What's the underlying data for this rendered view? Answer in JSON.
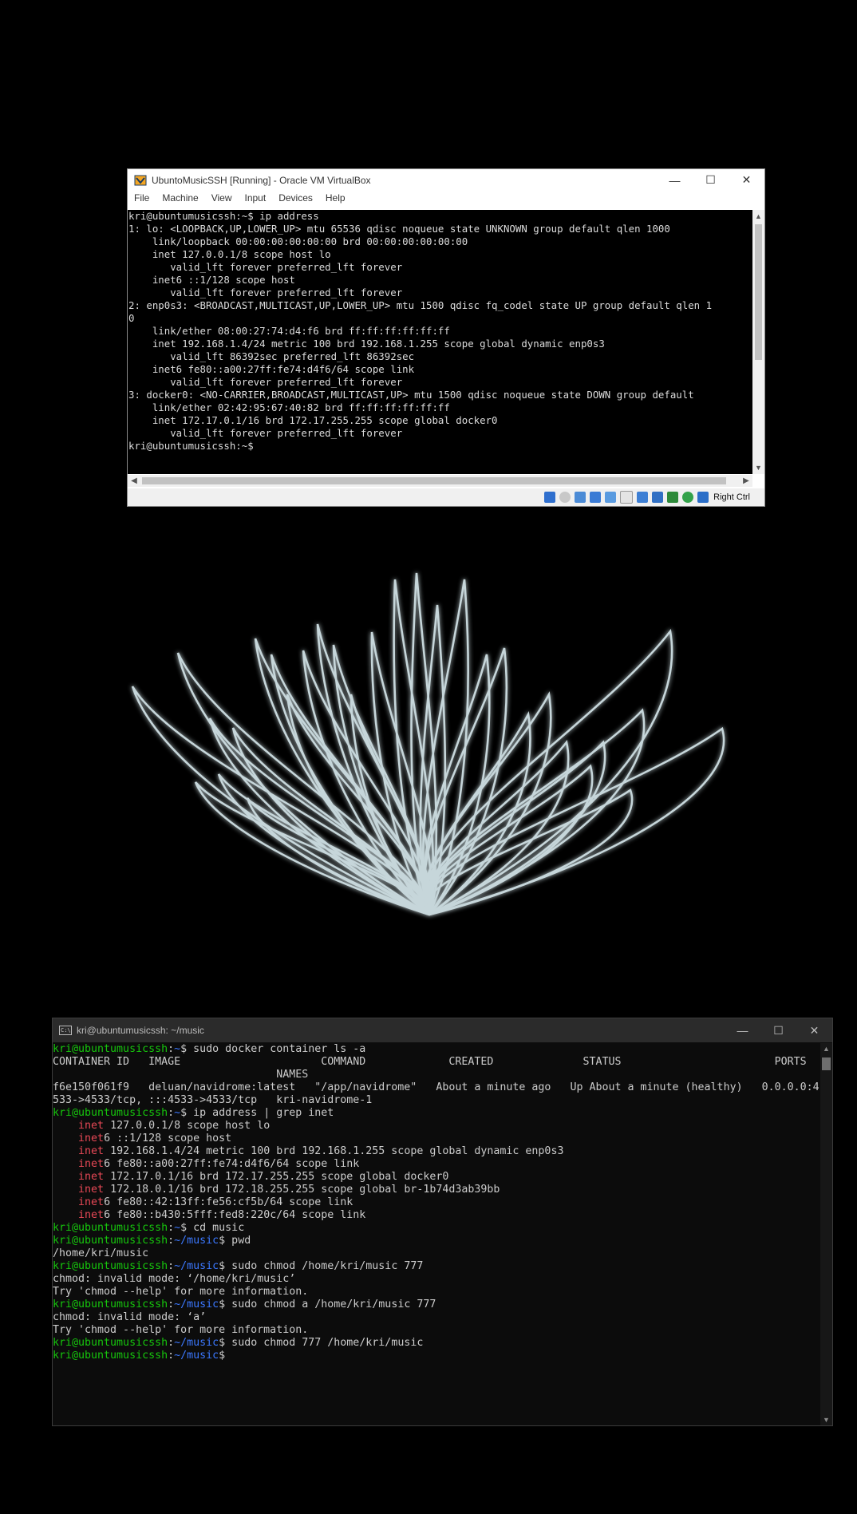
{
  "vbox": {
    "title": "UbuntoMusicSSH [Running] - Oracle VM VirtualBox",
    "menu": [
      "File",
      "Machine",
      "View",
      "Input",
      "Devices",
      "Help"
    ],
    "host_key": "Right Ctrl",
    "terminal_lines": [
      "kri@ubuntumusicssh:~$ ip address",
      "1: lo: <LOOPBACK,UP,LOWER_UP> mtu 65536 qdisc noqueue state UNKNOWN group default qlen 1000",
      "    link/loopback 00:00:00:00:00:00 brd 00:00:00:00:00:00",
      "    inet 127.0.0.1/8 scope host lo",
      "       valid_lft forever preferred_lft forever",
      "    inet6 ::1/128 scope host",
      "       valid_lft forever preferred_lft forever",
      "2: enp0s3: <BROADCAST,MULTICAST,UP,LOWER_UP> mtu 1500 qdisc fq_codel state UP group default qlen 1",
      "0",
      "    link/ether 08:00:27:74:d4:f6 brd ff:ff:ff:ff:ff:ff",
      "    inet 192.168.1.4/24 metric 100 brd 192.168.1.255 scope global dynamic enp0s3",
      "       valid_lft 86392sec preferred_lft 86392sec",
      "    inet6 fe80::a00:27ff:fe74:d4f6/64 scope link",
      "       valid_lft forever preferred_lft forever",
      "3: docker0: <NO-CARRIER,BROADCAST,MULTICAST,UP> mtu 1500 qdisc noqueue state DOWN group default",
      "    link/ether 02:42:95:67:40:82 brd ff:ff:ff:ff:ff:ff",
      "    inet 172.17.0.1/16 brd 172.17.255.255 scope global docker0",
      "       valid_lft forever preferred_lft forever",
      "kri@ubuntumusicssh:~$"
    ]
  },
  "wt": {
    "title": "kri@ubuntumusicssh: ~/music",
    "lines": [
      [
        {
          "t": "kri@ubuntumusicssh",
          "c": "green"
        },
        {
          "t": ":",
          "c": "white"
        },
        {
          "t": "~",
          "c": "blue"
        },
        {
          "t": "$ sudo docker container ls -a",
          "c": "white"
        }
      ],
      [
        {
          "t": "CONTAINER ID   IMAGE                      COMMAND             CREATED              STATUS                        PORTS",
          "c": "white"
        }
      ],
      [
        {
          "t": "                                   NAMES",
          "c": "white"
        }
      ],
      [
        {
          "t": "f6e150f061f9   deluan/navidrome:latest   \"/app/navidrome\"   About a minute ago   Up About a minute (healthy)   0.0.0.0:4",
          "c": "white"
        }
      ],
      [
        {
          "t": "533->4533/tcp, :::4533->4533/tcp   kri-navidrome-1",
          "c": "white"
        }
      ],
      [
        {
          "t": "kri@ubuntumusicssh",
          "c": "green"
        },
        {
          "t": ":",
          "c": "white"
        },
        {
          "t": "~",
          "c": "blue"
        },
        {
          "t": "$ ip address | grep inet",
          "c": "white"
        }
      ],
      [
        {
          "t": "    ",
          "c": "white"
        },
        {
          "t": "inet",
          "c": "red"
        },
        {
          "t": " 127.0.0.1/8 scope host lo",
          "c": "white"
        }
      ],
      [
        {
          "t": "    ",
          "c": "white"
        },
        {
          "t": "inet",
          "c": "red"
        },
        {
          "t": "6 ::1/128 scope host",
          "c": "white"
        }
      ],
      [
        {
          "t": "    ",
          "c": "white"
        },
        {
          "t": "inet",
          "c": "red"
        },
        {
          "t": " 192.168.1.4/24 metric 100 brd 192.168.1.255 scope global dynamic enp0s3",
          "c": "white"
        }
      ],
      [
        {
          "t": "    ",
          "c": "white"
        },
        {
          "t": "inet",
          "c": "red"
        },
        {
          "t": "6 fe80::a00:27ff:fe74:d4f6/64 scope link",
          "c": "white"
        }
      ],
      [
        {
          "t": "    ",
          "c": "white"
        },
        {
          "t": "inet",
          "c": "red"
        },
        {
          "t": " 172.17.0.1/16 brd 172.17.255.255 scope global docker0",
          "c": "white"
        }
      ],
      [
        {
          "t": "    ",
          "c": "white"
        },
        {
          "t": "inet",
          "c": "red"
        },
        {
          "t": " 172.18.0.1/16 brd 172.18.255.255 scope global br-1b74d3ab39bb",
          "c": "white"
        }
      ],
      [
        {
          "t": "    ",
          "c": "white"
        },
        {
          "t": "inet",
          "c": "red"
        },
        {
          "t": "6 fe80::42:13ff:fe56:cf5b/64 scope link",
          "c": "white"
        }
      ],
      [
        {
          "t": "    ",
          "c": "white"
        },
        {
          "t": "inet",
          "c": "red"
        },
        {
          "t": "6 fe80::b430:5fff:fed8:220c/64 scope link",
          "c": "white"
        }
      ],
      [
        {
          "t": "kri@ubuntumusicssh",
          "c": "green"
        },
        {
          "t": ":",
          "c": "white"
        },
        {
          "t": "~",
          "c": "blue"
        },
        {
          "t": "$ cd music",
          "c": "white"
        }
      ],
      [
        {
          "t": "kri@ubuntumusicssh",
          "c": "green"
        },
        {
          "t": ":",
          "c": "white"
        },
        {
          "t": "~/music",
          "c": "blue"
        },
        {
          "t": "$ pwd",
          "c": "white"
        }
      ],
      [
        {
          "t": "/home/kri/music",
          "c": "white"
        }
      ],
      [
        {
          "t": "kri@ubuntumusicssh",
          "c": "green"
        },
        {
          "t": ":",
          "c": "white"
        },
        {
          "t": "~/music",
          "c": "blue"
        },
        {
          "t": "$ sudo chmod /home/kri/music 777",
          "c": "white"
        }
      ],
      [
        {
          "t": "chmod: invalid mode: ‘/home/kri/music’",
          "c": "white"
        }
      ],
      [
        {
          "t": "Try 'chmod --help' for more information.",
          "c": "white"
        }
      ],
      [
        {
          "t": "kri@ubuntumusicssh",
          "c": "green"
        },
        {
          "t": ":",
          "c": "white"
        },
        {
          "t": "~/music",
          "c": "blue"
        },
        {
          "t": "$ sudo chmod a /home/kri/music 777",
          "c": "white"
        }
      ],
      [
        {
          "t": "chmod: invalid mode: ‘a’",
          "c": "white"
        }
      ],
      [
        {
          "t": "Try 'chmod --help' for more information.",
          "c": "white"
        }
      ],
      [
        {
          "t": "kri@ubuntumusicssh",
          "c": "green"
        },
        {
          "t": ":",
          "c": "white"
        },
        {
          "t": "~/music",
          "c": "blue"
        },
        {
          "t": "$ sudo chmod 777 /home/kri/music",
          "c": "white"
        }
      ],
      [
        {
          "t": "kri@ubuntumusicssh",
          "c": "green"
        },
        {
          "t": ":",
          "c": "white"
        },
        {
          "t": "~/music",
          "c": "blue"
        },
        {
          "t": "$",
          "c": "white"
        }
      ]
    ]
  },
  "colors": {
    "prompt_user": "#16c60c",
    "prompt_path": "#3b78ff",
    "grep_match": "#e74856",
    "lotus_stroke": "#c6d6da",
    "desktop_bg": "#000000"
  },
  "icons": {
    "vbox_app": "virtualbox-icon",
    "wt_app": "cmd-icon",
    "minimize": "minimize-icon",
    "maximize": "maximize-icon",
    "close": "close-icon",
    "decoration": "lotus-outline"
  }
}
